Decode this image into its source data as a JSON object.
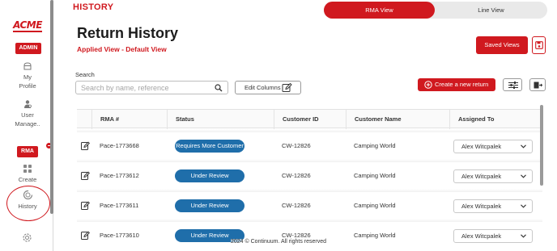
{
  "app": {
    "logo": "ACME",
    "breadcrumb": "HISTORY",
    "footer": "2024 © Continuum. All rights reserved"
  },
  "sidebar": {
    "admin_label": "ADMIN",
    "my_profile_label": "My\nProfile",
    "user_manage_label": "User\nManage..",
    "rma_label": "RMA",
    "create_label": "Create",
    "history_label": "History"
  },
  "view_toggle": {
    "rma_view": "RMA View",
    "line_view": "Line View",
    "active": "RMA View"
  },
  "header": {
    "title": "Return History",
    "applied_view": "Applied View - Default View",
    "saved_views_label": "Saved Views"
  },
  "toolbar": {
    "search_label": "Search",
    "search_placeholder": "Search by name, reference",
    "search_value": "",
    "edit_columns_label": "Edit Columns",
    "create_label": "Create a new return"
  },
  "table": {
    "columns": [
      "RMA #",
      "Status",
      "Customer ID",
      "Customer Name",
      "Assigned To"
    ],
    "rows": [
      {
        "rma": "Pace-1773668",
        "status": "Requires More Customer",
        "customer_id": "CW-12826",
        "customer_name": "Camping World",
        "assigned_to": "Alex Witcpalek"
      },
      {
        "rma": "Pace-1773612",
        "status": "Under Review",
        "customer_id": "CW-12826",
        "customer_name": "Camping World",
        "assigned_to": "Alex Witcpalek"
      },
      {
        "rma": "Pace-1773611",
        "status": "Under Review",
        "customer_id": "CW-12826",
        "customer_name": "Camping World",
        "assigned_to": "Alex Witcpalek"
      },
      {
        "rma": "Pace-1773610",
        "status": "Under Review",
        "customer_id": "CW-12826",
        "customer_name": "Camping World",
        "assigned_to": "Alex Witcpalek"
      }
    ]
  },
  "colors": {
    "brand_red": "#d0191f",
    "status_blue": "#1f6eaa"
  },
  "icons": {
    "sidebar": [
      "profile-icon",
      "user-manage-icon",
      "create-grid-icon",
      "history-icon",
      "settings-icon"
    ],
    "toolbar": [
      "search-icon",
      "edit-columns-icon",
      "plus-circle-icon",
      "filter-sliders-icon",
      "export-icon",
      "save-icon"
    ],
    "table": [
      "edit-icon",
      "chevron-down-icon"
    ]
  }
}
